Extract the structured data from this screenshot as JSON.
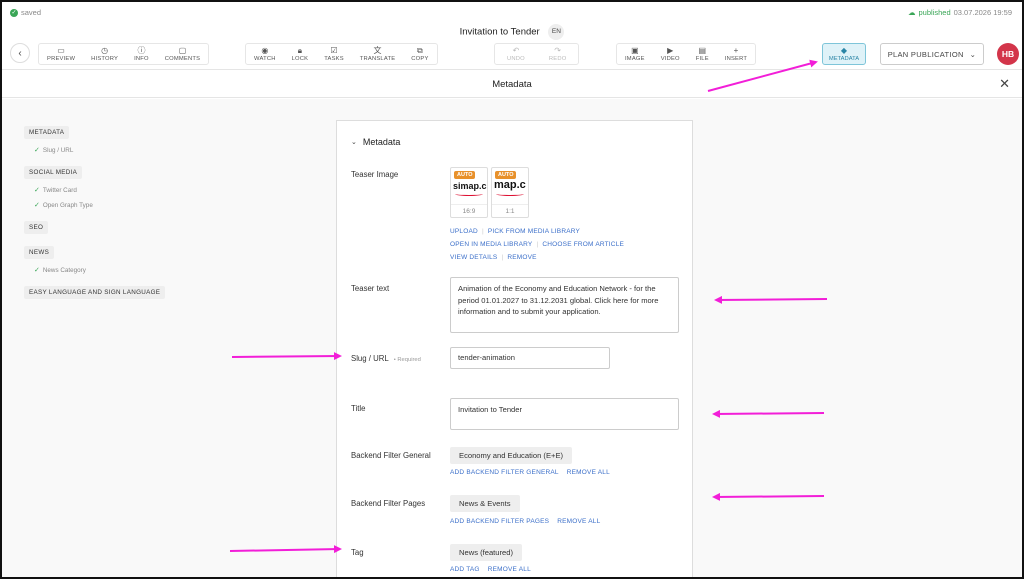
{
  "status": {
    "saved_label": "saved",
    "published_label": "published",
    "published_date": "03.07.2026 19:59"
  },
  "document": {
    "title": "Invitation to Tender",
    "language": "EN"
  },
  "toolbar": {
    "group1": [
      {
        "icon": "preview-icon",
        "label": "PREVIEW"
      },
      {
        "icon": "history-icon",
        "label": "HISTORY"
      },
      {
        "icon": "info-icon",
        "label": "INFO"
      },
      {
        "icon": "comments-icon",
        "label": "COMMENTS"
      }
    ],
    "group2": [
      {
        "icon": "watch-icon",
        "label": "WATCH"
      },
      {
        "icon": "lock-icon",
        "label": "LOCK"
      },
      {
        "icon": "tasks-icon",
        "label": "TASKS"
      },
      {
        "icon": "translate-icon",
        "label": "TRANSLATE"
      },
      {
        "icon": "copy-icon",
        "label": "COPY"
      }
    ],
    "group3": [
      {
        "icon": "undo-icon",
        "label": "UNDO"
      },
      {
        "icon": "redo-icon",
        "label": "REDO"
      }
    ],
    "group4": [
      {
        "icon": "image-icon",
        "label": "IMAGE"
      },
      {
        "icon": "video-icon",
        "label": "VIDEO"
      },
      {
        "icon": "file-icon",
        "label": "FILE"
      },
      {
        "icon": "plus-icon",
        "label": "INSERT"
      }
    ],
    "metadata_label": "METADATA",
    "plan_publication_label": "PLAN PUBLICATION",
    "avatar_initials": "HB"
  },
  "metadata_header": {
    "title": "Metadata"
  },
  "sidebar": {
    "sections": [
      {
        "label": "METADATA",
        "subs": [
          "Slug / URL"
        ]
      },
      {
        "label": "SOCIAL MEDIA",
        "subs": [
          "Twitter Card",
          "Open Graph Type"
        ]
      },
      {
        "label": "SEO",
        "subs": []
      },
      {
        "label": "NEWS",
        "subs": [
          "News Category"
        ]
      },
      {
        "label": "EASY LANGUAGE AND SIGN LANGUAGE",
        "subs": []
      }
    ]
  },
  "panel": {
    "section_title": "Metadata",
    "teaser_image": {
      "label": "Teaser Image",
      "thumbs": [
        {
          "badge": "AUTO",
          "logo": "simap.ch",
          "ratio": "16:9"
        },
        {
          "badge": "AUTO",
          "logo": "map.c",
          "ratio": "1:1"
        }
      ],
      "links_row1": [
        "UPLOAD",
        "PICK FROM MEDIA LIBRARY"
      ],
      "links_row2": [
        "OPEN IN MEDIA LIBRARY",
        "CHOOSE FROM ARTICLE"
      ],
      "links_row3": [
        "VIEW DETAILS",
        "REMOVE"
      ]
    },
    "teaser_text": {
      "label": "Teaser text",
      "value": "Animation of the Economy and Education Network - for the period 01.01.2027 to 31.12.2031 global. Click here for more information and to submit your application."
    },
    "slug": {
      "label": "Slug / URL",
      "required": "• Required",
      "value": "tender-animation"
    },
    "title": {
      "label": "Title",
      "value": "Invitation to Tender"
    },
    "backend_filter_general": {
      "label": "Backend Filter General",
      "chip": "Economy and Education (E+E)",
      "add": "ADD BACKEND FILTER GENERAL",
      "remove": "REMOVE ALL"
    },
    "backend_filter_pages": {
      "label": "Backend Filter Pages",
      "chip": "News & Events",
      "add": "ADD BACKEND FILTER PAGES",
      "remove": "REMOVE ALL"
    },
    "tag": {
      "label": "Tag",
      "chip": "News (featured)",
      "add": "ADD TAG",
      "remove": "REMOVE ALL"
    }
  },
  "colors": {
    "accent": "#3b6fc9",
    "avatar": "#d3354a",
    "annotation_arrow": "#f21ed8",
    "metadata_active": "#dff2f8"
  }
}
